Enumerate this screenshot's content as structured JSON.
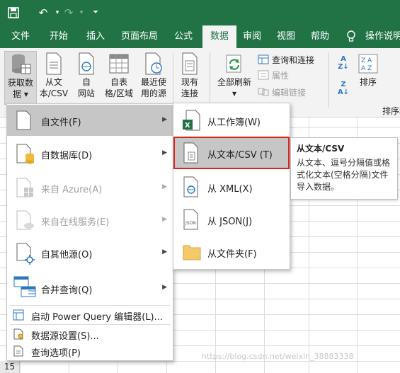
{
  "colors": {
    "excel_green": "#217346",
    "ribbon_bg": "#f3f3f3",
    "highlight": "#c6c6c6",
    "select_border": "#d9261c"
  },
  "quick_access": {
    "save_icon": "save-icon",
    "undo_icon": "undo-icon",
    "redo_icon": "redo-icon",
    "customize_icon": "customize-icon"
  },
  "tabs": [
    "文件",
    "开始",
    "插入",
    "页面布局",
    "公式",
    "数据",
    "审阅",
    "视图",
    "帮助",
    "操作说明"
  ],
  "active_tab": "数据",
  "ribbon": {
    "get_data": {
      "line1": "获取数",
      "line2": "据 ▾"
    },
    "from_text": {
      "line1": "从文",
      "line2": "本/CSV"
    },
    "from_web": {
      "line1": "自",
      "line2": "网站"
    },
    "from_table": {
      "line1": "自表",
      "line2": "格/区域"
    },
    "recent_sources": {
      "line1": "最近使",
      "line2": "用的源"
    },
    "existing_conn": {
      "line1": "现有",
      "line2": "连接"
    },
    "refresh_all": {
      "line1": "全部刷新",
      "line2": "▾"
    },
    "queries_conn": "查询和连接",
    "properties": "属性",
    "edit_links": "编辑链接",
    "sort": "排序",
    "sort_group": "排序和"
  },
  "menu": {
    "items": [
      {
        "label": "自文件(F)",
        "submenu": true
      },
      {
        "label": "自数据库(D)",
        "submenu": true
      },
      {
        "label": "来自 Azure(A)",
        "submenu": true,
        "disabled": true
      },
      {
        "label": "来自在线服务(E)",
        "submenu": true,
        "disabled": true
      },
      {
        "label": "自其他源(O)",
        "submenu": true
      },
      {
        "label": "合并查询(Q)",
        "submenu": true
      }
    ],
    "small_items": [
      "启动 Power Query 编辑器(L)...",
      "数据源设置(S)...",
      "查询选项(P)"
    ]
  },
  "submenu": {
    "items": [
      "从工作簿(W)",
      "从文本/CSV (T)",
      "从 XML(X)",
      "从 JSON(J)",
      "从文件夹(F)"
    ]
  },
  "tooltip": {
    "title": "从文本/CSV",
    "body": "从文本、逗号分隔值或格式化文本(空格分隔)文件导入数据。"
  },
  "row_number": "15",
  "watermark": "https://blog.csdn.net/weixin_38883338"
}
